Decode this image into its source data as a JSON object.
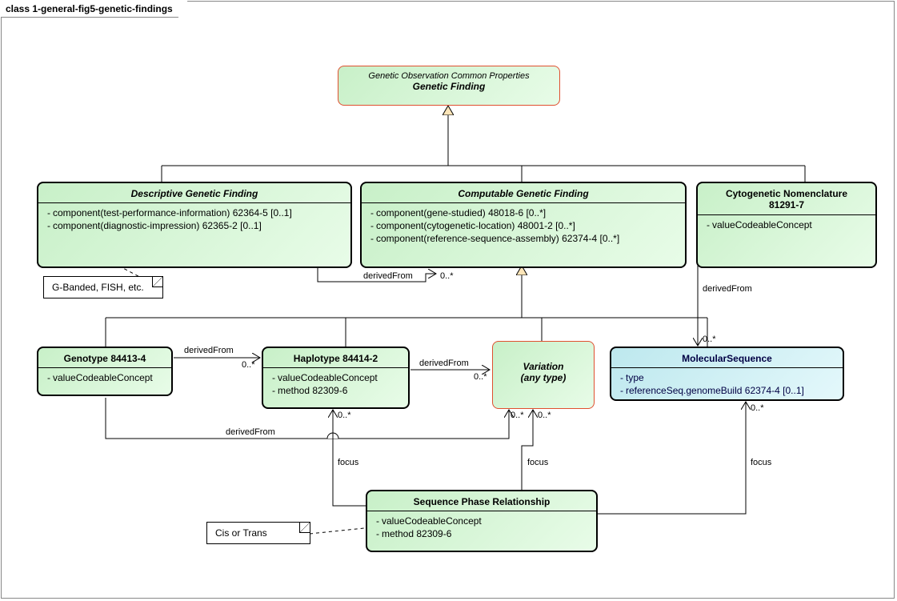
{
  "frame": {
    "title": "class 1-general-fig5-genetic-findings"
  },
  "geneticFinding": {
    "sub": "Genetic Observation Common Properties",
    "title": "Genetic Finding"
  },
  "descriptive": {
    "title": "Descriptive Genetic Finding",
    "a1": "component(test-performance-information) 62364-5 [0..1]",
    "a2": "component(diagnostic-impression) 62365-2 [0..1]"
  },
  "computable": {
    "title": "Computable Genetic Finding",
    "a1": "component(gene-studied) 48018-6 [0..*]",
    "a2": "component(cytogenetic-location) 48001-2 [0..*]",
    "a3": "component(reference-sequence-assembly) 62374-4 [0..*]"
  },
  "cytogenetic": {
    "title1": "Cytogenetic Nomenclature",
    "title2": "81291-7",
    "a1": "valueCodeableConcept"
  },
  "genotype": {
    "title": "Genotype  84413-4",
    "a1": "valueCodeableConcept"
  },
  "haplotype": {
    "title": "Haplotype 84414-2",
    "a1": "valueCodeableConcept",
    "a2": "method 82309-6"
  },
  "variation": {
    "title1": "Variation",
    "title2": "(any type)"
  },
  "molseq": {
    "title": "MolecularSequence",
    "a1": "type",
    "a2": "referenceSeq.genomeBuild 62374-4 [0..1]"
  },
  "seqphase": {
    "title": "Sequence Phase Relationship",
    "a1": "valueCodeableConcept",
    "a2": "method 82309-6"
  },
  "notes": {
    "gbanded": "G-Banded, FISH, etc.",
    "cistrans": "Cis or Trans"
  },
  "labels": {
    "derivedFrom": "derivedFrom",
    "focus": "focus",
    "m0star": "0..*"
  }
}
